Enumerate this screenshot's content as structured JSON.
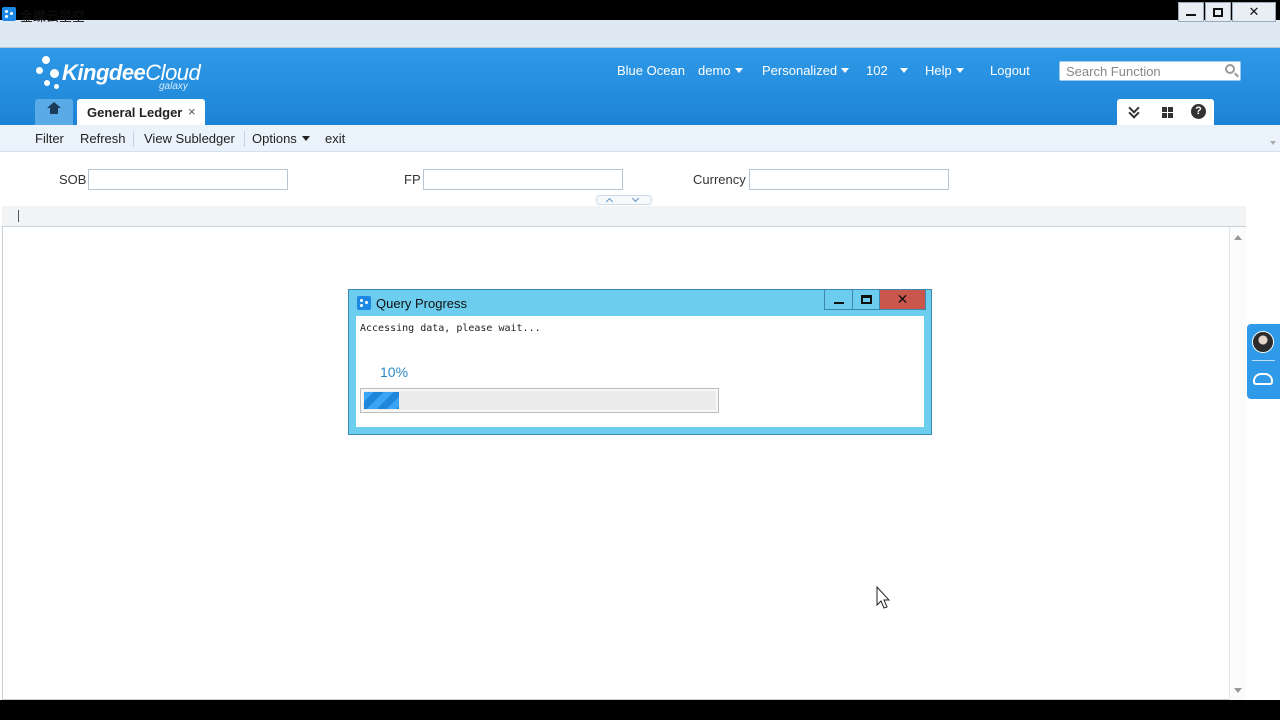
{
  "os_window": {
    "title": "金蝶云星空",
    "close_glyph": "✕"
  },
  "brand": {
    "logo_main": "Kingdee",
    "logo_second": "Cloud",
    "logo_sub": "galaxy"
  },
  "topnav": {
    "items": [
      {
        "label": "Blue Ocean",
        "dropdown": false
      },
      {
        "label": "demo",
        "dropdown": true
      },
      {
        "label": "Personalized",
        "dropdown": true
      },
      {
        "label": "102",
        "dropdown": true
      },
      {
        "label": "Help",
        "dropdown": true
      },
      {
        "label": "Logout",
        "dropdown": false
      }
    ],
    "search_placeholder": "Search Function"
  },
  "tabs": {
    "active_label": "General Ledger",
    "close_glyph": "×",
    "help_glyph": "?"
  },
  "toolbar": {
    "filter": "Filter",
    "refresh": "Refresh",
    "view_subledger": "View Subledger",
    "options": "Options",
    "exit": "exit"
  },
  "filters": {
    "sob_label": "SOB",
    "sob_value": "",
    "fp_label": "FP",
    "fp_value": "",
    "currency_label": "Currency",
    "currency_value": ""
  },
  "dialog": {
    "title": "Query Progress",
    "message": "Accessing data, please wait...",
    "percent_label": "10%",
    "progress_fraction": 0.1,
    "close_glyph": "✕"
  },
  "colors": {
    "header_blue": "#1d83d6",
    "dialog_frame": "#6ccdee",
    "dialog_close": "#c9574e",
    "progress_blue": "#3aa6f3"
  }
}
